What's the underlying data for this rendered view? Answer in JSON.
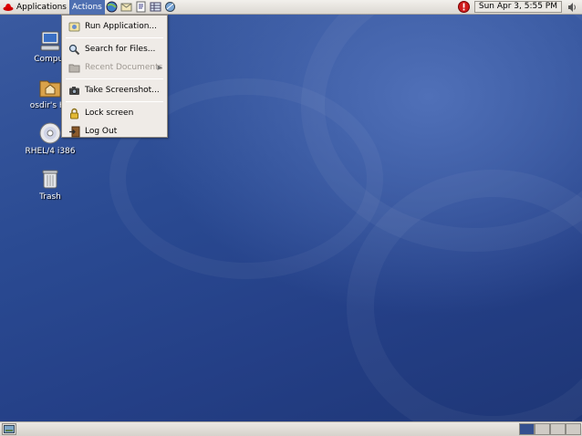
{
  "top_panel": {
    "applications_label": "Applications",
    "actions_label": "Actions",
    "launchers": [
      "web-browser-icon",
      "email-icon",
      "office-writer-icon",
      "office-spreadsheet-icon",
      "network-icon"
    ],
    "clock": "Sun Apr  3,  5:55 PM"
  },
  "actions_menu": {
    "items": [
      {
        "label": "Run Application...",
        "icon": "run-application-icon",
        "enabled": true
      },
      {
        "label": "Search for Files...",
        "icon": "search-icon",
        "enabled": true
      },
      {
        "label": "Recent Documents",
        "icon": "folder-icon",
        "enabled": false,
        "submenu": true
      },
      {
        "label": "Take Screenshot...",
        "icon": "camera-icon",
        "enabled": true
      },
      {
        "label": "Lock screen",
        "icon": "lock-icon",
        "enabled": true
      },
      {
        "label": "Log Out",
        "icon": "logout-icon",
        "enabled": true
      }
    ]
  },
  "desktop_icons": [
    {
      "label": "Comput",
      "icon": "computer-icon"
    },
    {
      "label": "osdir's Ho",
      "icon": "home-folder-icon"
    },
    {
      "label": "RHEL/4 i386",
      "icon": "cd-icon"
    },
    {
      "label": "Trash",
      "icon": "trash-icon"
    }
  ],
  "bottom_panel": {
    "workspaces": 4,
    "active_workspace": 1
  },
  "colors": {
    "desktop_blue": "#2c4a8c",
    "menu_active": "#4e6fb1",
    "panel_bg": "#e6e3de"
  }
}
